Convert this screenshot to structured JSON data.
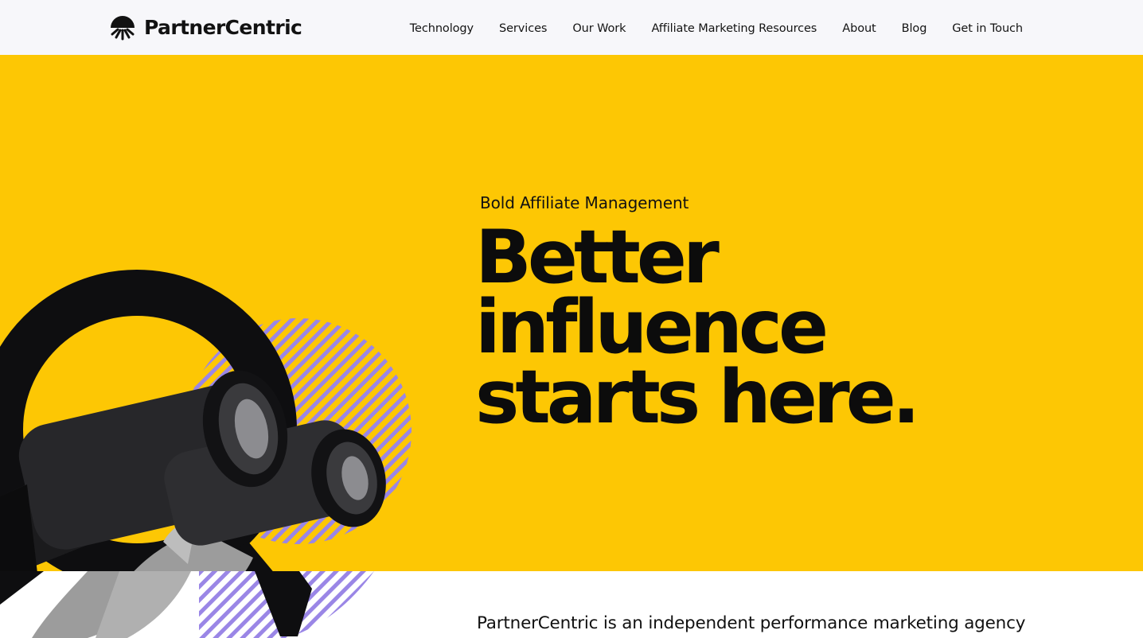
{
  "header": {
    "brand": "PartnerCentric",
    "logo_icon": "sunrise-logo-icon",
    "nav": [
      {
        "label": "Technology"
      },
      {
        "label": "Services"
      },
      {
        "label": "Our Work"
      },
      {
        "label": "Affiliate Marketing Resources"
      },
      {
        "label": "About"
      },
      {
        "label": "Blog"
      },
      {
        "label": "Get in Touch"
      }
    ]
  },
  "hero": {
    "eyebrow": "Bold Affiliate Management",
    "headline": [
      "Better",
      "influence",
      "starts here."
    ],
    "image": "binoculars-in-hand",
    "colors": {
      "background": "#fdc704",
      "ring": "#0e0e10",
      "stripes": "#9a86e6",
      "text": "#0c0c0c"
    }
  },
  "intro": {
    "text": "PartnerCentric is an independent performance marketing agency"
  }
}
